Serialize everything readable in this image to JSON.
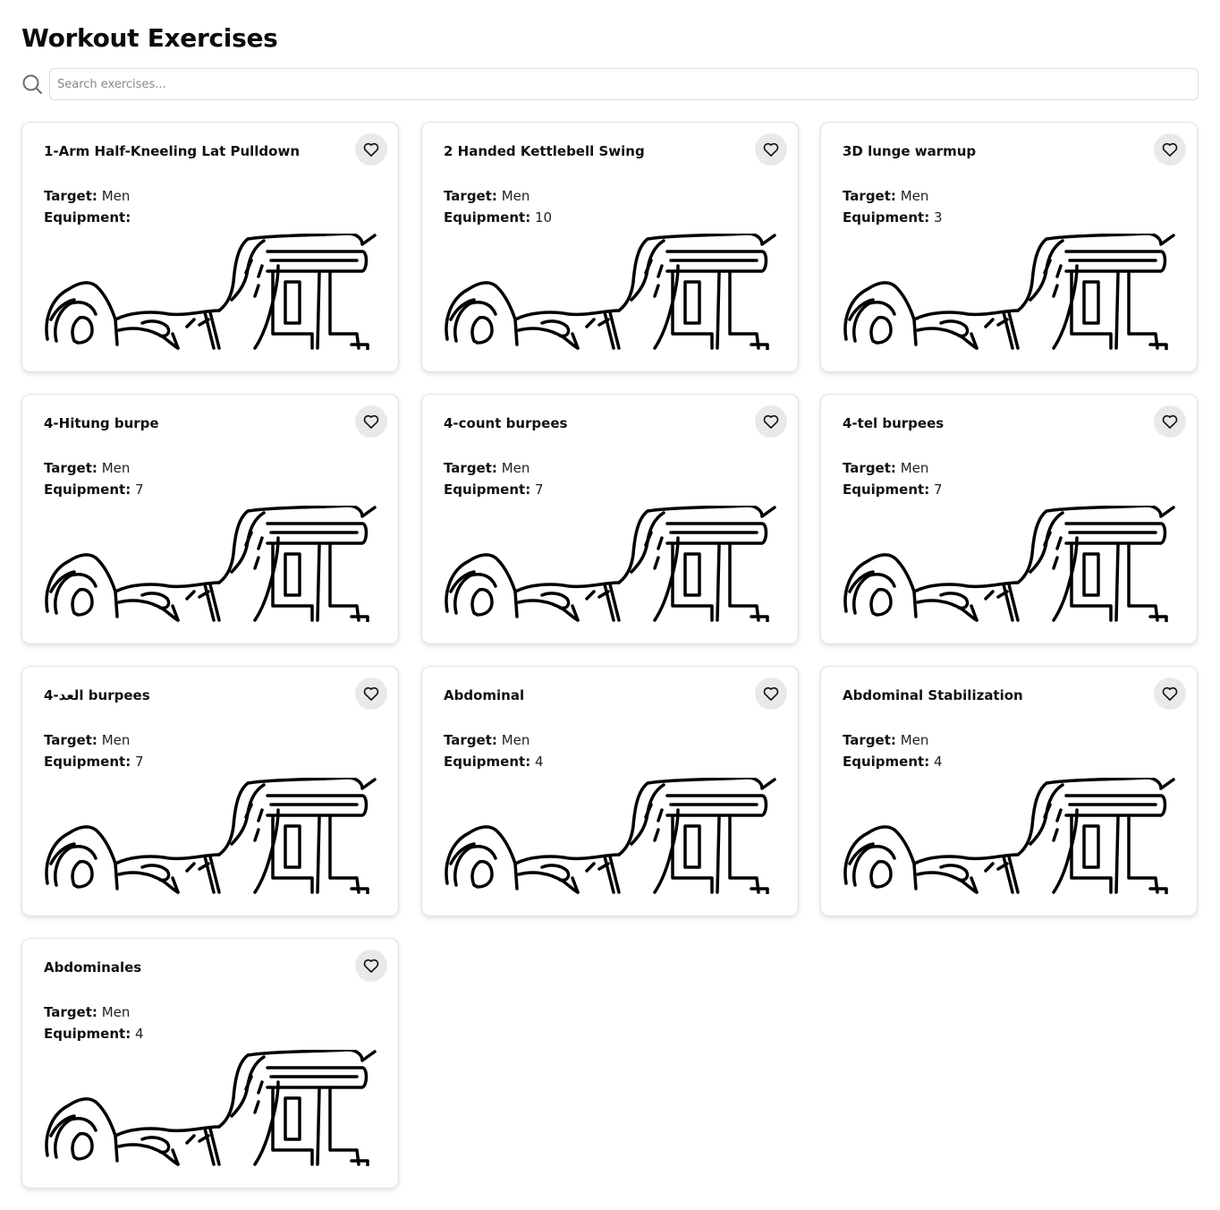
{
  "title": "Workout Exercises",
  "search": {
    "placeholder": "Search exercises..."
  },
  "labels": {
    "target": "Target:",
    "equipment": "Equipment:"
  },
  "colors": {
    "fav_bg": "#e9e9ec",
    "card_border": "#e2e2e2"
  },
  "icons": {
    "search": "search-icon",
    "favorite": "heart-outline-icon"
  },
  "exercises": [
    {
      "name": "1-Arm Half-Kneeling Lat Pulldown",
      "target": "Men",
      "equipment": ""
    },
    {
      "name": "2 Handed Kettlebell Swing",
      "target": "Men",
      "equipment": "10"
    },
    {
      "name": "3D lunge warmup",
      "target": "Men",
      "equipment": "3"
    },
    {
      "name": "4-Hitung burpe",
      "target": "Men",
      "equipment": "7"
    },
    {
      "name": "4-count burpees",
      "target": "Men",
      "equipment": "7"
    },
    {
      "name": "4-tel burpees",
      "target": "Men",
      "equipment": "7"
    },
    {
      "name": "4-العد burpees",
      "target": "Men",
      "equipment": "7"
    },
    {
      "name": "Abdominal",
      "target": "Men",
      "equipment": "4"
    },
    {
      "name": "Abdominal Stabilization",
      "target": "Men",
      "equipment": "4"
    },
    {
      "name": "Abdominales",
      "target": "Men",
      "equipment": "4"
    }
  ]
}
